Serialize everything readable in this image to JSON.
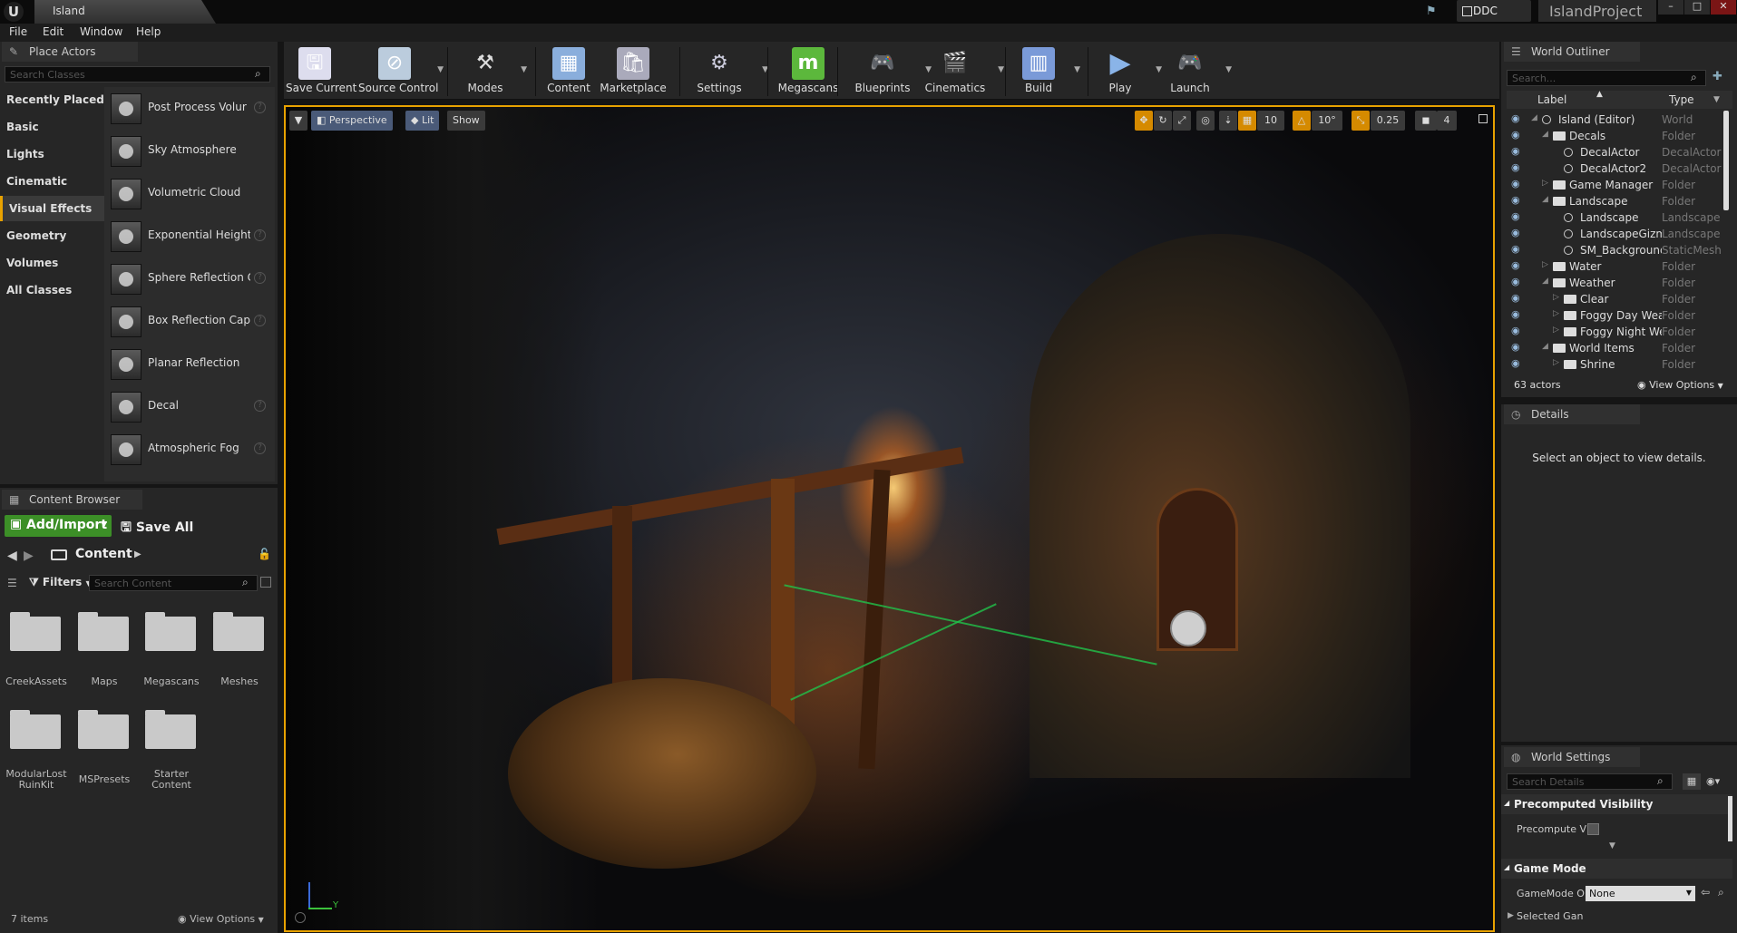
{
  "title_bar": {
    "tab": "Island",
    "ddc": "DDC",
    "project": "IslandProject",
    "min": "–",
    "max": "□",
    "close": "✕"
  },
  "menu": [
    "File",
    "Edit",
    "Window",
    "Help"
  ],
  "place_actors": {
    "tab": "Place Actors",
    "search_placeholder": "Search Classes",
    "categories": [
      "Recently Placed",
      "Basic",
      "Lights",
      "Cinematic",
      "Visual Effects",
      "Geometry",
      "Volumes",
      "All Classes"
    ],
    "active_category": "Visual Effects",
    "actors": [
      "Post Process Volur",
      "Sky Atmosphere",
      "Volumetric Cloud",
      "Exponential Height",
      "Sphere Reflection C",
      "Box Reflection Capt",
      "Planar Reflection",
      "Decal",
      "Atmospheric Fog"
    ]
  },
  "toolbar": {
    "buttons": [
      "Save Current",
      "Source Control",
      "Modes",
      "Content",
      "Marketplace",
      "Settings",
      "Megascans",
      "Blueprints",
      "Cinematics",
      "Build",
      "Play",
      "Launch"
    ]
  },
  "viewport": {
    "perspective": "Perspective",
    "lit": "Lit",
    "show": "Show",
    "grid_snap": "10",
    "rotation_snap": "10°",
    "scale_snap": "0.25",
    "camera_speed": "4",
    "axis_y": "Y"
  },
  "content_browser": {
    "tab": "Content Browser",
    "add_import": "Add/Import",
    "save_all": "Save All",
    "path": "Content",
    "filters": "Filters",
    "search_placeholder": "Search Content",
    "folders": [
      "CreekAssets",
      "Maps",
      "Megascans",
      "Meshes",
      "ModularLost RuinKit",
      "MSPresets",
      "Starter Content"
    ],
    "items_count": "7 items",
    "view_options": "View Options"
  },
  "world_outliner": {
    "tab": "World Outliner",
    "search_placeholder": "Search...",
    "col_label": "Label",
    "col_type": "Type",
    "rows": [
      {
        "label": "Island (Editor)",
        "type": "World",
        "indent": 0,
        "expanded": true
      },
      {
        "label": "Decals",
        "type": "Folder",
        "indent": 1,
        "expanded": true
      },
      {
        "label": "DecalActor",
        "type": "DecalActor",
        "indent": 2
      },
      {
        "label": "DecalActor2",
        "type": "DecalActor",
        "indent": 2
      },
      {
        "label": "Game Manager",
        "type": "Folder",
        "indent": 1,
        "expanded": false
      },
      {
        "label": "Landscape",
        "type": "Folder",
        "indent": 1,
        "expanded": true
      },
      {
        "label": "Landscape",
        "type": "Landscape",
        "indent": 2
      },
      {
        "label": "LandscapeGizmo",
        "type": "Landscape",
        "indent": 2
      },
      {
        "label": "SM_Background",
        "type": "StaticMesh",
        "indent": 2
      },
      {
        "label": "Water",
        "type": "Folder",
        "indent": 1,
        "expanded": false
      },
      {
        "label": "Weather",
        "type": "Folder",
        "indent": 1,
        "expanded": true
      },
      {
        "label": "Clear",
        "type": "Folder",
        "indent": 2,
        "expanded": false
      },
      {
        "label": "Foggy Day Weath",
        "type": "Folder",
        "indent": 2,
        "expanded": false
      },
      {
        "label": "Foggy Night Wea",
        "type": "Folder",
        "indent": 2,
        "expanded": false
      },
      {
        "label": "World Items",
        "type": "Folder",
        "indent": 1,
        "expanded": true
      },
      {
        "label": "Shrine",
        "type": "Folder",
        "indent": 2,
        "expanded": false
      }
    ],
    "actors_count": "63 actors",
    "view_options": "View Options"
  },
  "details": {
    "tab": "Details",
    "empty_message": "Select an object to view details."
  },
  "world_settings": {
    "tab": "World Settings",
    "search_placeholder": "Search Details",
    "section_precomputed": "Precomputed Visibility",
    "precompute_label": "Precompute V",
    "section_game_mode": "Game Mode",
    "gamemode_label": "GameMode O",
    "gamemode_value": "None",
    "selected_label": "Selected Gan"
  }
}
